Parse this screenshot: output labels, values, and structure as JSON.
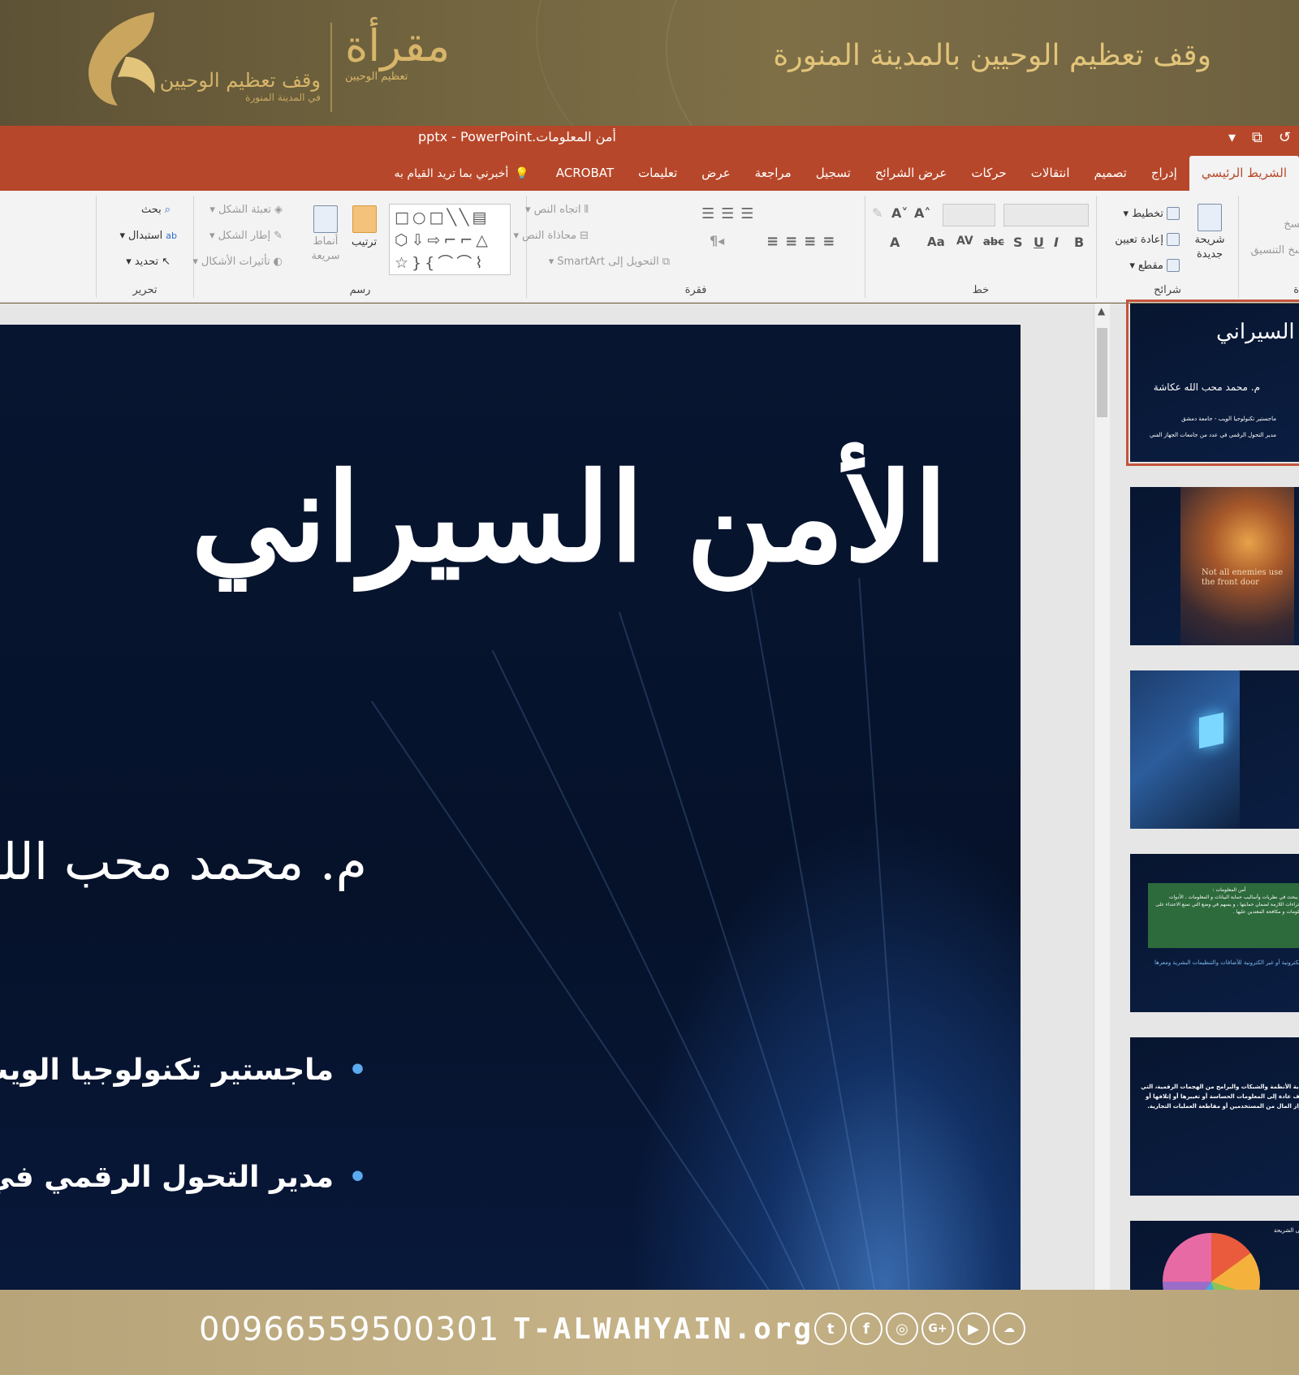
{
  "banner": {
    "title": "وقف تعظيم الوحيين بالمدينة المنورة",
    "logo_main": "وقف تعظيم الوحيين",
    "logo_sub": "في المدينة المنورة",
    "logo_mark": "مقرأة",
    "logo_mark_sub": "تعظيم الوحيين"
  },
  "app": {
    "document_title": "أمن المعلومات.pptx  -  PowerPoint",
    "tabs": [
      "الشريط الرئيسي",
      "إدراج",
      "تصميم",
      "انتقالات",
      "حركات",
      "عرض الشرائح",
      "تسجيل",
      "مراجعة",
      "عرض",
      "تعليمات",
      "ACROBAT"
    ],
    "active_tab": "الشريط الرئيسي",
    "tell_me": "أخبرني بما تريد القيام به"
  },
  "ribbon": {
    "slides_group": {
      "label": "شرائح",
      "new_slide": "شريحة جديدة",
      "layout": "تخطيط",
      "reset": "إعادة تعيين",
      "section": "مقطع"
    },
    "font_group": {
      "label": "خط",
      "buttons": [
        "B",
        "I",
        "U",
        "S",
        "abc",
        "AV",
        "Aa",
        "A"
      ]
    },
    "paragraph_group": {
      "label": "فقرة",
      "text_direction": "اتجاه النص",
      "align_text": "محاذاة النص",
      "smartart": "التحويل إلى SmartArt"
    },
    "drawing_group": {
      "label": "رسم",
      "arrange": "ترتيب",
      "quick_styles": "أنماط سريعة",
      "shape_fill": "تعبئة الشكل",
      "shape_outline": "إطار الشكل",
      "shape_effects": "تأثيرات الأشكال"
    },
    "editing_group": {
      "label": "تحرير",
      "find": "بحث",
      "replace": "استبدال",
      "select": "تحديد"
    },
    "clipboard_partial": {
      "label": "ة",
      "format_painter": "نسخ التنسيق",
      "copy": "نسخ"
    }
  },
  "slide": {
    "title": "الأمن السيراني",
    "author": "م. محمد محب الله كد",
    "bullets": [
      "ماجستير تكنولوجيا الويب - جامعة",
      "مدير التحول الرقمي في عدد من ج"
    ]
  },
  "thumbnails": [
    {
      "title": "ن السيراني",
      "author": "م. محمد محب الله عكاشة",
      "lines": [
        "ماجستير تكنولوجيا الويب - جامعة دمشق",
        "مدير التحول الرقمي في عدد من جامعات الجهاز الفني"
      ]
    },
    {
      "caption": "Not all enemies use the front door"
    },
    {},
    {
      "box_title": "أمن المعلومات :",
      "box_text": "علم يبحث في نظريات وأساليب حماية البيانات و المعلومات ، الأدوات والإجراءات اللازمة لضمان حمايتها ، و يسهم في وضع التي تمنع الاعتداء على المعلومات و مكافحة المعتدين عليها .",
      "footer": "المعلومات الكترونية أو غير الكترونية للأضافات والتنظيمات البشرية ومعرها"
    },
    {
      "text": "حماية الأنظمة والشبكات والبرامج من الهجمات الرقمية، التي تهدف عادة إلى المعلومات الحساسة أو تغييرها أو إتلافها أو ابتزاز المال من المستخدمين أو مقاطعة العمليات التجارية."
    },
    {
      "note": "على الشريحة"
    }
  ],
  "footer": {
    "phone": "00966559500301",
    "website": "T-ALWAHYAIN.org",
    "socials": [
      "twitter",
      "facebook",
      "instagram",
      "google-plus",
      "youtube",
      "soundcloud"
    ]
  }
}
